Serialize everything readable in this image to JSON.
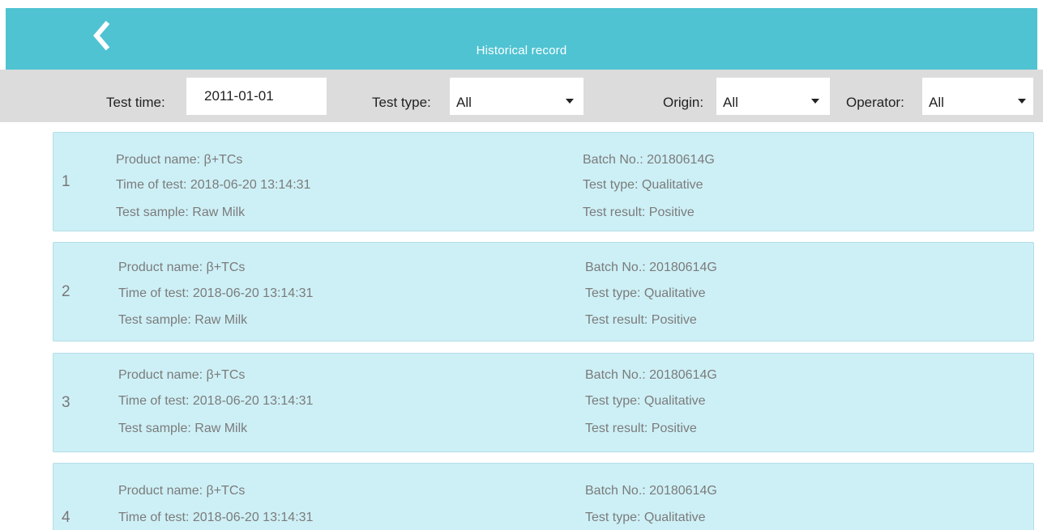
{
  "header": {
    "title": "Historical record",
    "back_icon": "chevron-left-icon"
  },
  "filters": {
    "test_time_label": "Test time:",
    "test_time_value": "2011-01-01",
    "test_type_label": "Test type:",
    "test_type_value": "All",
    "origin_label": "Origin:",
    "origin_value": "All",
    "operator_label": "Operator:",
    "operator_value": "All"
  },
  "records": [
    {
      "index": "1",
      "product_name": "Product name: β+TCs",
      "time_of_test": "Time of test: 2018-06-20  13:14:31",
      "test_sample": "Test sample: Raw Milk",
      "batch_no": "Batch No.: 20180614G",
      "test_type": "Test type: Qualitative",
      "test_result": "Test result: Positive"
    },
    {
      "index": "2",
      "product_name": "Product name: β+TCs",
      "time_of_test": "Time of test: 2018-06-20  13:14:31",
      "test_sample": "Test sample: Raw Milk",
      "batch_no": "Batch No.: 20180614G",
      "test_type": "Test type: Qualitative",
      "test_result": "Test result: Positive"
    },
    {
      "index": "3",
      "product_name": "Product name: β+TCs",
      "time_of_test": "Time of test: 2018-06-20  13:14:31",
      "test_sample": "Test sample: Raw Milk",
      "batch_no": "Batch No.: 20180614G",
      "test_type": "Test type: Qualitative",
      "test_result": "Test result: Positive"
    },
    {
      "index": "4",
      "product_name": "Product name: β+TCs",
      "time_of_test": "Time of test: 2018-06-20  13:14:31",
      "batch_no": "Batch No.: 20180614G",
      "test_type": "Test type: Qualitative"
    }
  ],
  "colors": {
    "header_bg": "#4fc3d2",
    "filter_bar_bg": "#dcdcdc",
    "record_bg": "#cdf0f6",
    "record_border": "#b4dde6",
    "record_text": "#7b7b7b"
  }
}
